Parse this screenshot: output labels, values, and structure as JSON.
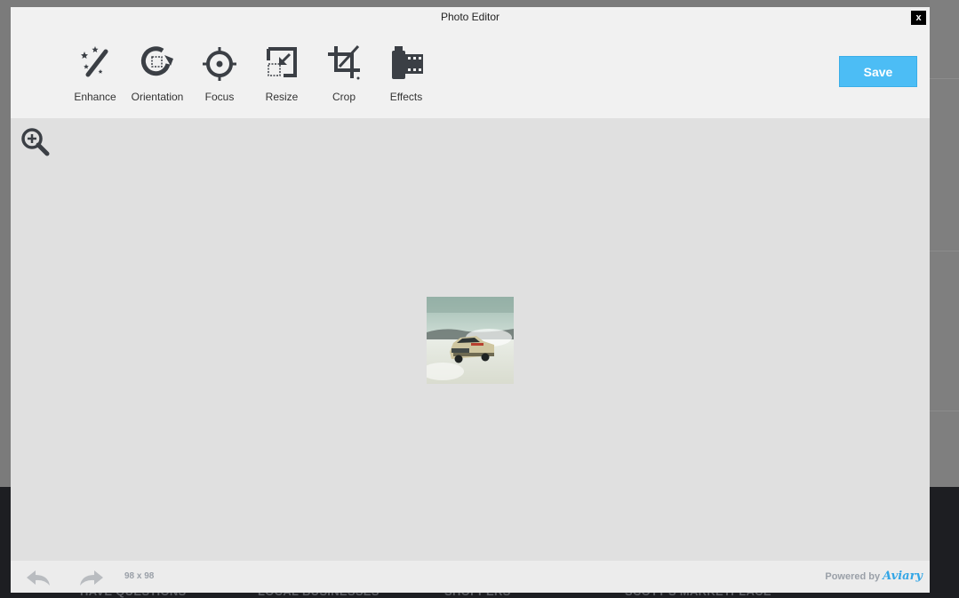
{
  "background": {
    "footer_links": [
      "HAVE QUESTIONS",
      "LOCAL BUSINESSES",
      "SHOPPERS",
      "SCOTT'S MARKETPLACE"
    ]
  },
  "modal": {
    "title": "Photo Editor",
    "close_label": "x",
    "save_label": "Save",
    "tools": [
      {
        "label": "Enhance",
        "icon": "magic-wand-icon"
      },
      {
        "label": "Orientation",
        "icon": "rotate-icon"
      },
      {
        "label": "Focus",
        "icon": "crosshair-icon"
      },
      {
        "label": "Resize",
        "icon": "resize-icon"
      },
      {
        "label": "Crop",
        "icon": "crop-icon"
      },
      {
        "label": "Effects",
        "icon": "film-effects-icon"
      }
    ],
    "zoom_icon": "zoom-in-icon",
    "image_dimensions": "98 x 98",
    "powered_by": "Powered by",
    "brand": "Aviary"
  },
  "colors": {
    "accent": "#4cbdf5",
    "icon": "#3b3f45",
    "canvas": "#e0e0e0",
    "panel": "#f1f1f1"
  }
}
